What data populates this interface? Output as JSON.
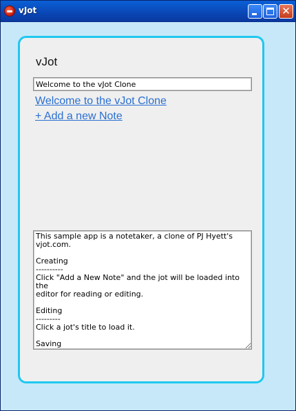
{
  "window": {
    "title": "vJot",
    "controls": {
      "minimize": "minimize",
      "maximize": "maximize",
      "close": "✕"
    }
  },
  "app": {
    "heading": "vJot",
    "title_input_value": "Welcome to the vJot Clone",
    "links": [
      {
        "label": "Welcome to the vJot Clone"
      },
      {
        "label": "+ Add a new Note"
      }
    ],
    "editor_text": "This sample app is a notetaker, a clone of PJ Hyett's\nvjot.com.\n\nCreating\n----------\nClick \"Add a New Note\" and the jot will be loaded into the\neditor for reading or editing.\n\nEditing\n---------\nClick a jot's title to load it.\n\nSaving"
  },
  "colors": {
    "accent_border": "#1ec8f0",
    "link": "#2a6fd1",
    "titlebar": "#0a4fc0"
  }
}
